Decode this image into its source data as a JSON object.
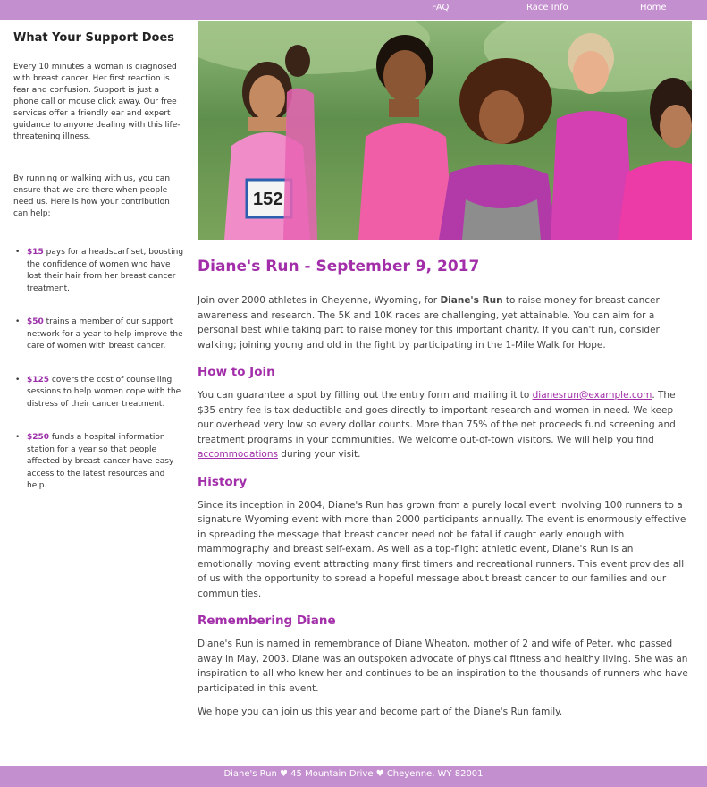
{
  "nav": {
    "faq": "FAQ",
    "race_info": "Race Info",
    "home": "Home"
  },
  "sidebar": {
    "title": "What Your Support Does",
    "intro": "Every 10 minutes a woman is diagnosed with breast cancer. Her first reaction is fear and confusion. Support is just a phone call or mouse click away. Our free services offer a friendly ear and expert guidance to anyone dealing with this life-threatening illness.",
    "intro2": "By running or walking with us, you can ensure that we are there when people need us. Here is how your contribution can help:",
    "items": [
      {
        "amount": "$15",
        "text": " pays for a headscarf set, boosting the confidence of women who have lost their hair from her breast cancer treatment."
      },
      {
        "amount": "$50",
        "text": " trains a member of our support network for a year to help improve the care of women with breast cancer."
      },
      {
        "amount": "$125",
        "text": " covers the cost of counselling sessions to help women cope with the distress of their cancer treatment."
      },
      {
        "amount": "$250",
        "text": " funds a hospital information station for a year so that people affected by breast cancer have easy access to the latest resources and help."
      }
    ]
  },
  "colors": {
    "accent": "#a22ea9",
    "bar": "#c48fcf"
  },
  "main": {
    "title": "Diane's Run - September 9, 2017",
    "intro_a": "Join over 2000 athletes in Cheyenne, Wyoming, for ",
    "intro_bold": "Diane's Run",
    "intro_b": " to raise money for breast cancer awareness and research. The 5K and 10K races are challenging, yet attainable. You can aim for a personal best while taking part to raise money for this important charity. If you can't run, consider walking; joining young and old in the fight by participating in the 1-Mile Walk for Hope.",
    "how_title": "How to Join",
    "how_a": "You can guarantee a spot by filling out the entry form and mailing it to ",
    "how_email": "dianesrun@example.com",
    "how_b": ". The $35 entry fee is tax deductible and goes directly to important research and women in need. We keep our overhead very low so every dollar counts. More than 75% of the net proceeds fund screening and treatment programs in your communities. We welcome out-of-town visitors. We will help you find ",
    "how_link": "accommodations",
    "how_c": " during your visit.",
    "history_title": "History",
    "history": "Since its inception in 2004, Diane's Run has grown from a purely local event involving 100 runners to a signature Wyoming event with more than 2000 participants annually. The event is enormously effective in spreading the message that breast cancer need not be fatal if caught early enough with mammography and breast self-exam. As well as a top-flight athletic event, Diane's Run is an emotionally moving event attracting many first timers and recreational runners. This event provides all of us with the opportunity to spread a hopeful message about breast cancer to our families and our communities.",
    "remember_title": "Remembering Diane",
    "remember": "Diane's Run is named in remembrance of Diane Wheaton, mother of 2 and wife of Peter, who passed away in May, 2003. Diane was an outspoken advocate of physical fitness and healthy living. She was an inspiration to all who knew her and continues to be an inspiration to the thousands of runners who have participated in this event.",
    "closing": "We hope you can join us this year and become part of the Diane's Run family."
  },
  "hero": {
    "bib_number": "152"
  },
  "footer": {
    "text": "Diane's Run ♥ 45 Mountain Drive ♥ Cheyenne, WY 82001"
  }
}
